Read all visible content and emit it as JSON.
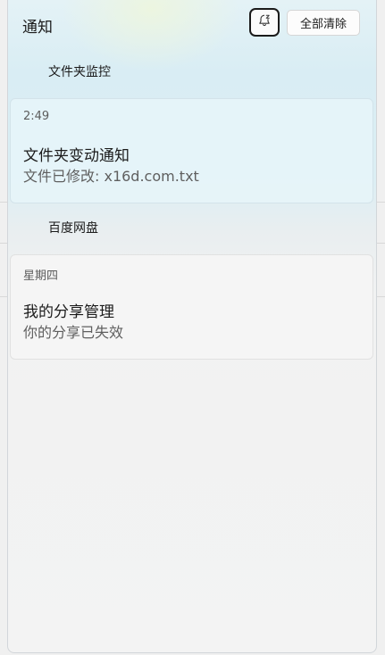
{
  "header": {
    "title": "通知",
    "clear_all_label": "全部清除",
    "focus_icon": "bell-snooze-icon"
  },
  "groups": [
    {
      "name": "文件夹监控",
      "notification": {
        "time": "2:49",
        "title": "文件夹变动通知",
        "body": "文件已修改: x16d.com.txt"
      }
    },
    {
      "name": "百度网盘",
      "notification": {
        "time": "星期四",
        "title": "我的分享管理",
        "body": "你的分享已失效"
      }
    }
  ]
}
